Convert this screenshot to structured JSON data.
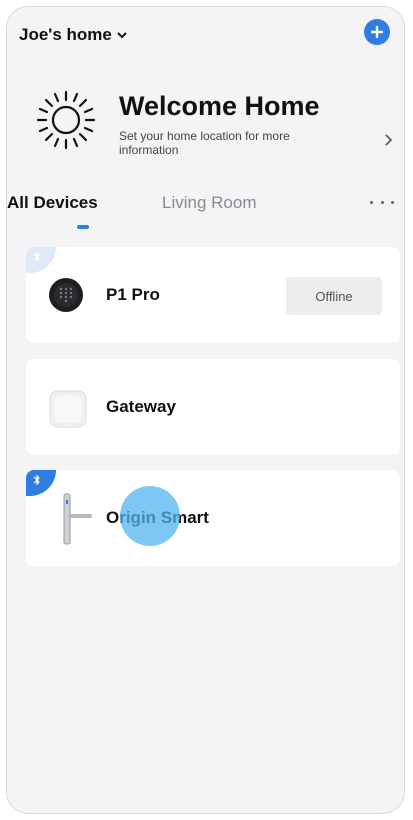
{
  "header": {
    "home_name": "Joe's home",
    "add_icon": "plus-icon",
    "accent": "#2f7de1"
  },
  "welcome": {
    "title": "Welcome Home",
    "subtitle": "Set your home location for more information",
    "icon": "sun-icon"
  },
  "tabs": [
    {
      "label": "All Devices",
      "active": true
    },
    {
      "label": "Living Room",
      "active": false
    }
  ],
  "devices": [
    {
      "name": "P1 Pro",
      "status": "Offline",
      "bluetooth": true,
      "icon": "keypad-lock-icon"
    },
    {
      "name": "Gateway",
      "bluetooth": false,
      "icon": "gateway-icon"
    },
    {
      "name": "Origin Smart",
      "bluetooth": true,
      "icon": "door-handle-icon"
    }
  ]
}
